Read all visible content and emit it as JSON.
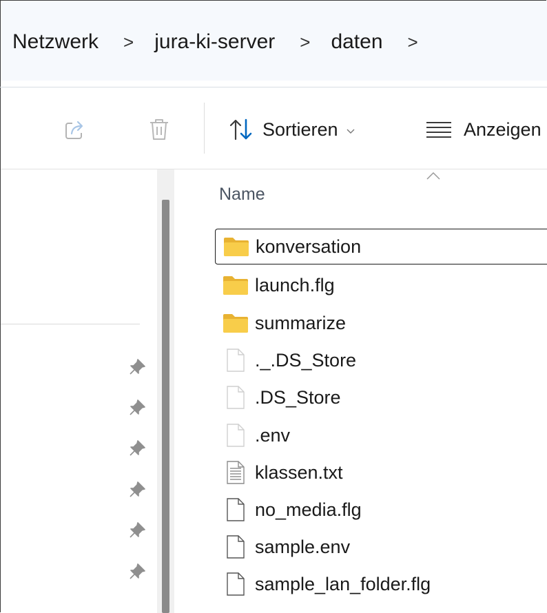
{
  "breadcrumb": {
    "items": [
      "Netzwerk",
      "jura-ki-server",
      "daten"
    ],
    "separator": ">"
  },
  "toolbar": {
    "share_icon": "share-icon",
    "delete_icon": "trash-icon",
    "sort_label": "Sortieren",
    "view_label": "Anzeigen"
  },
  "file_list": {
    "column_name": "Name",
    "sort_direction": "ascending",
    "items": [
      {
        "name": "konversation",
        "type": "folder",
        "selected": true
      },
      {
        "name": "launch.flg",
        "type": "folder"
      },
      {
        "name": "summarize",
        "type": "folder"
      },
      {
        "name": "._.DS_Store",
        "type": "file"
      },
      {
        "name": ".DS_Store",
        "type": "file"
      },
      {
        "name": ".env",
        "type": "file"
      },
      {
        "name": "klassen.txt",
        "type": "text-file"
      },
      {
        "name": "no_media.flg",
        "type": "file"
      },
      {
        "name": "sample.env",
        "type": "file"
      },
      {
        "name": "sample_lan_folder.flg",
        "type": "file"
      }
    ]
  },
  "navigation_pane": {
    "pinned_count": 6
  },
  "colors": {
    "folder": "#f3c33b",
    "accent": "#0067c0",
    "address_bar_bg": "#f6f9fd"
  }
}
